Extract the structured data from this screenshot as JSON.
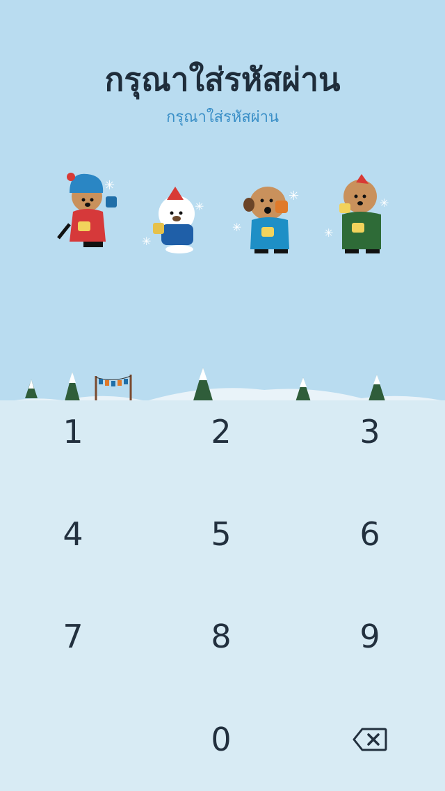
{
  "header": {
    "title": "กรุณาใส่รหัสผ่าน",
    "subtitle": "กรุณาใส่รหัสผ่าน"
  },
  "passcode": {
    "entered_count": 0,
    "total_digits": 4,
    "indicators": [
      {
        "character": "quokka-blue-hat-red-sweater",
        "filled": false
      },
      {
        "character": "white-bear-santa-hat",
        "filled": false
      },
      {
        "character": "quokka-earmuffs-blue-sweater",
        "filled": false
      },
      {
        "character": "quokka-red-hat-green-sweater",
        "filled": false
      }
    ]
  },
  "keypad": {
    "keys": [
      "1",
      "2",
      "3",
      "4",
      "5",
      "6",
      "7",
      "8",
      "9",
      "0"
    ],
    "delete_icon": "backspace-icon"
  },
  "colors": {
    "sky": "#b9dcf0",
    "snow": "#d8ebf4",
    "title": "#1f2d3b",
    "subtitle": "#3a8fc7",
    "keys": "#22303e"
  }
}
